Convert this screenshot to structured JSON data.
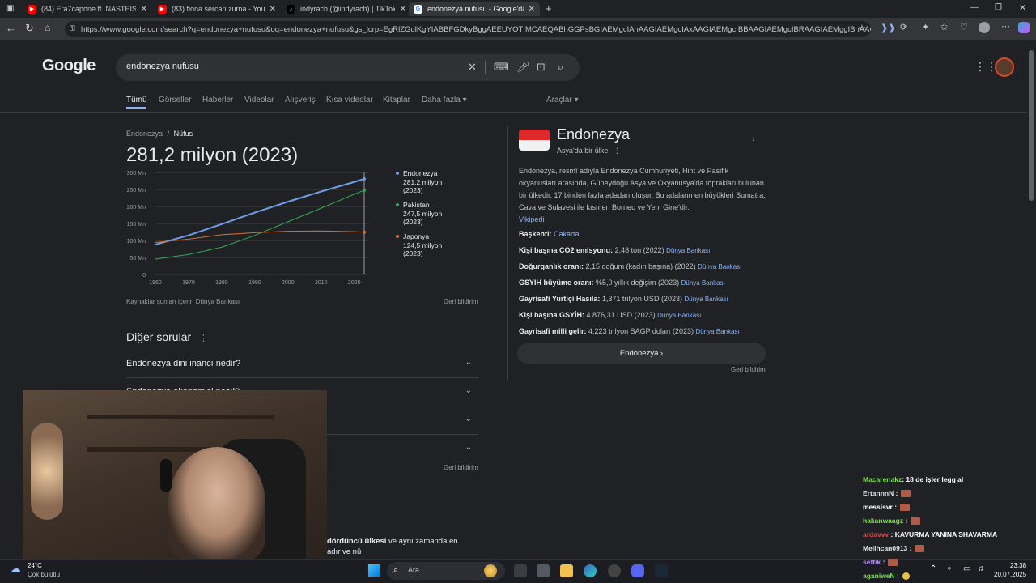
{
  "tabs": [
    {
      "label": "(84) Era7capone ft. NASTEISHA - …",
      "icon": "youtube-icon",
      "color": "#ff0000"
    },
    {
      "label": "(83) fiona sercan zurna - YouTube",
      "icon": "youtube-icon",
      "color": "#ff0000"
    },
    {
      "label": "indyrach (@indyrach) | TikTok",
      "icon": "tiktok-icon",
      "color": "#000000"
    },
    {
      "label": "endonezya nufusu - Google'da A…",
      "icon": "google-icon",
      "color": "#4285f4"
    }
  ],
  "address": {
    "url": "https://www.google.com/search?q=endonezya+nufusu&oq=endonezya+nufusu&gs_lcrp=EgRlZGdlKgYIABBFGDkyBggAEEUYOTIMCAEQABhGGPsBGIAEMgcIAhAAGIAEMgcIAxAAGIAEMgcIBBAAGIAEMgcIBRAAGIAEMggIBhAAGBYY..."
  },
  "search": {
    "logo": "Google",
    "query": "endonezya nufusu"
  },
  "navtabs": [
    "Tümü",
    "Görseller",
    "Haberler",
    "Videolar",
    "Alışveriş",
    "Kısa videolar",
    "Kitaplar",
    "Daha fazla ▾"
  ],
  "tools": "Araçlar ▾",
  "breadcrumb": {
    "first": "Endonezya",
    "sep": "/",
    "second": "Nüfus"
  },
  "headline": "281,2 milyon (2023)",
  "chart_data": {
    "type": "line",
    "x": [
      1960,
      1970,
      1980,
      1990,
      2000,
      2010,
      2020,
      2023
    ],
    "xticks": [
      "1960",
      "1970",
      "1980",
      "1990",
      "2000",
      "2010",
      "2020"
    ],
    "yticks": [
      "0",
      "50 Mn",
      "100 Mn",
      "150 Mn",
      "200 Mn",
      "250 Mn",
      "300 Mn"
    ],
    "ylim": [
      0,
      300
    ],
    "series": [
      {
        "name": "Endonezya",
        "color": "#6f9ee8",
        "values": [
          88,
          115,
          148,
          182,
          214,
          244,
          272,
          281.2
        ]
      },
      {
        "name": "Pakistan",
        "color": "#34a853",
        "values": [
          45,
          59,
          80,
          115,
          155,
          195,
          236,
          247.5
        ]
      },
      {
        "name": "Japonya",
        "color": "#d2733b",
        "values": [
          94,
          104,
          117,
          123,
          127,
          128,
          126,
          124.5
        ]
      }
    ],
    "legend": [
      {
        "line1": "Endonezya",
        "line2": "281,2 milyon",
        "line3": "(2023)"
      },
      {
        "line1": "Pakistan",
        "line2": "247,5 milyon",
        "line3": "(2023)"
      },
      {
        "line1": "Japonya",
        "line2": "124,5 milyon",
        "line3": "(2023)"
      }
    ]
  },
  "sources": "Kaynaklar şunları içerir: Dünya Bankası",
  "feedback": "Geri bildirim",
  "other_questions": {
    "title": "Diğer sorular",
    "items": [
      "Endonezya dini inancı nedir?",
      "Endonezya ekonomisi nasıl?",
      "",
      ""
    ]
  },
  "snippet": {
    "line1": "dördüncü ülkesi",
    "line1b": " ve aynı zamanda en",
    "line2": "adır ve nü"
  },
  "kp": {
    "title": "Endonezya",
    "subtitle": "Asya'da bir ülke",
    "description": "Endonezya, resmî adıyla Endonezya Cumhuriyeti, Hint ve Pasifik okyanusları arasında, Güneydoğu Asya ve Okyanusya'da toprakları bulunan bir ülkedir. 17 binden fazla adadan oluşur. Bu adaların en büyükleri Sumatra, Cava ve Sulavesi ile kısmen Borneo ve Yeni Gine'dir.",
    "wiki": "Vikipedi",
    "facts": [
      {
        "label": "Başkenti:",
        "value": "Cakarta",
        "src": ""
      },
      {
        "label": "Kişi başına CO2 emisyonu:",
        "value": "2,48 ton (2022)",
        "src": "Dünya Bankası"
      },
      {
        "label": "Doğurganlık oranı:",
        "value": "2,15 doğum (kadın başına) (2022)",
        "src": "Dünya Bankası"
      },
      {
        "label": "GSYİH büyüme oranı:",
        "value": "%5,0 yıllık değişim (2023)",
        "src": "Dünya Bankası"
      },
      {
        "label": "Gayrisafi Yurtiçi Hasıla:",
        "value": "1,371 trilyon USD (2023)",
        "src": "Dünya Bankası"
      },
      {
        "label": "Kişi başına GSYİH:",
        "value": "4.876,31 USD (2023)",
        "src": "Dünya Bankası"
      },
      {
        "label": "Gayrisafi milli gelir:",
        "value": "4,223 trilyon SAGP doları (2023)",
        "src": "Dünya Bankası"
      }
    ],
    "button": "Endonezya ›",
    "feedback": "Geri bildirim"
  },
  "chat": [
    {
      "user": "Macarenakz",
      "color": "#7ed957",
      "msg": ": 18 de işler legg al",
      "emote": false
    },
    {
      "user": "ErtannnN",
      "color": "#dfe8f0",
      "msg": " :",
      "emote": true
    },
    {
      "user": "messisvr",
      "color": "#ffffff",
      "msg": " :",
      "emote": true
    },
    {
      "user": "hakanwaagz",
      "color": "#7ed957",
      "msg": " :",
      "emote": true
    },
    {
      "user": "ardavvv",
      "color": "#d94a4a",
      "msg": " : KAVURMA YANINA SHAVARMA",
      "emote": false
    },
    {
      "user": "Mellhcan0913",
      "color": "#dfe8f0",
      "msg": " :",
      "emote": true
    },
    {
      "user": "seffik",
      "color": "#b48bff",
      "msg": " :",
      "emote": true
    },
    {
      "user": "aganiweN",
      "color": "#7ed957",
      "msg": " :",
      "emote": true
    }
  ],
  "taskbar": {
    "weather_temp": "24°C",
    "weather_desc": "Çok bulutlu",
    "search": "Ara",
    "time": "23:38",
    "date": "20.07.2025"
  }
}
